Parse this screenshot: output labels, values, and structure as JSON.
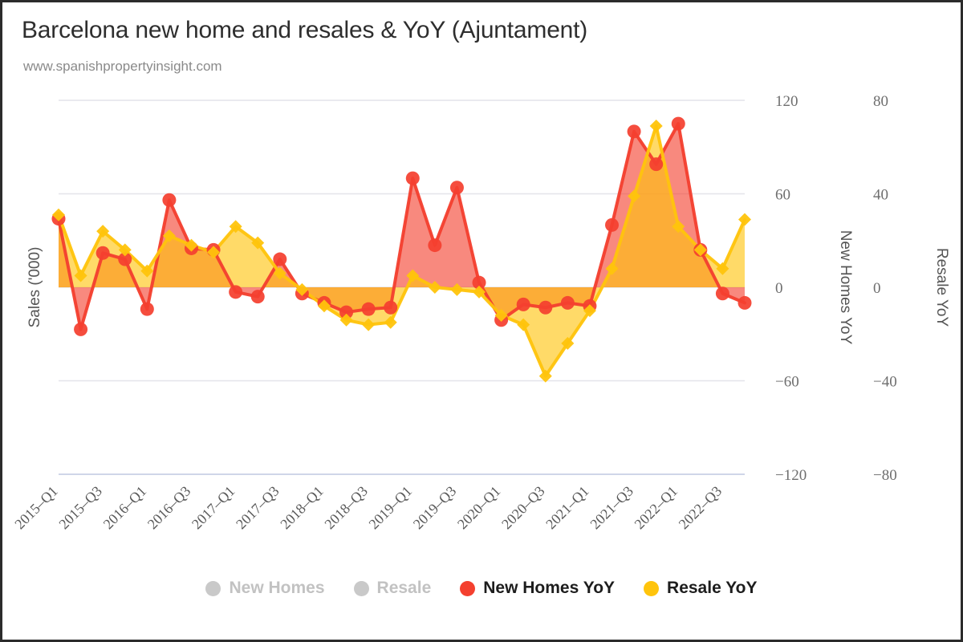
{
  "header": {
    "title": "Barcelona new home and resales & YoY (Ajuntament)",
    "subtitle": "www.spanishpropertyinsight.com"
  },
  "axes": {
    "left_title": "Sales ('000)",
    "mid_title": "New Homes YoY",
    "right_title": "Resale YoY",
    "left_ticks": [
      "120",
      "60",
      "0",
      "-60",
      "-120"
    ],
    "right_ticks": [
      "80",
      "40",
      "0",
      "-40",
      "-80"
    ]
  },
  "legend": {
    "items": [
      {
        "label": "New Homes",
        "color": "#c9c9c9",
        "active": false
      },
      {
        "label": "Resale",
        "color": "#c9c9c9",
        "active": false
      },
      {
        "label": "New Homes YoY",
        "color": "#f4402f",
        "active": true
      },
      {
        "label": "Resale YoY",
        "color": "#ffc40c",
        "active": true
      }
    ]
  },
  "chart_data": {
    "type": "line",
    "title": "Barcelona new home and resales & YoY (Ajuntament)",
    "subtitle": "www.spanishpropertyinsight.com",
    "xlabel": "",
    "ylabel": "Sales ('000)",
    "y2label": "New Homes YoY",
    "y3label": "Resale YoY",
    "grid": true,
    "legend_position": "bottom",
    "ylim": [
      -120,
      120
    ],
    "y2lim": [
      -80,
      80
    ],
    "yticks": [
      120,
      60,
      0,
      -60,
      -120
    ],
    "y2ticks": [
      80,
      40,
      0,
      -40,
      -80
    ],
    "x": [
      "2015-Q1",
      "2015-Q2",
      "2015-Q3",
      "2015-Q4",
      "2016-Q1",
      "2016-Q2",
      "2016-Q3",
      "2016-Q4",
      "2017-Q1",
      "2017-Q2",
      "2017-Q3",
      "2017-Q4",
      "2018-Q1",
      "2018-Q2",
      "2018-Q3",
      "2018-Q4",
      "2019-Q1",
      "2019-Q2",
      "2019-Q3",
      "2019-Q4",
      "2020-Q1",
      "2020-Q2",
      "2020-Q3",
      "2020-Q4",
      "2021-Q1",
      "2021-Q2",
      "2021-Q3",
      "2021-Q4",
      "2022-Q1",
      "2022-Q2",
      "2022-Q3",
      "2022-Q4"
    ],
    "xtick_labels": [
      "2015-Q1",
      "2015-Q3",
      "2016-Q1",
      "2016-Q3",
      "2017-Q1",
      "2017-Q3",
      "2018-Q1",
      "2018-Q3",
      "2019-Q1",
      "2019-Q3",
      "2020-Q1",
      "2020-Q3",
      "2021-Q1",
      "2021-Q3",
      "2022-Q1",
      "2022-Q3"
    ],
    "xtick_indices": [
      0,
      2,
      4,
      6,
      8,
      10,
      12,
      14,
      16,
      18,
      20,
      22,
      24,
      26,
      28,
      30
    ],
    "series": [
      {
        "name": "New Homes YoY",
        "color": "#f4402f",
        "marker": "circle",
        "axis": "y2-new-homes",
        "unit": "%",
        "values": [
          44,
          -27,
          22,
          18,
          -14,
          56,
          25,
          24,
          -3,
          -6,
          18,
          -4,
          -10,
          -16,
          -14,
          -13,
          70,
          27,
          64,
          3,
          -21,
          -11,
          -13,
          -10,
          -12,
          40,
          100,
          79,
          105,
          24,
          -4,
          -10
        ]
      },
      {
        "name": "Resale YoY",
        "color": "#ffc40c",
        "marker": "diamond",
        "axis": "y3-resale",
        "unit": "%",
        "values": [
          31,
          5,
          24,
          16,
          7,
          22,
          18,
          15,
          26,
          19,
          6,
          -1,
          -8,
          -14,
          -16,
          -15,
          5,
          0,
          -1,
          -2,
          -12,
          -16,
          -38,
          -24,
          -10,
          8,
          39,
          69,
          26,
          16,
          8,
          29
        ]
      }
    ]
  }
}
